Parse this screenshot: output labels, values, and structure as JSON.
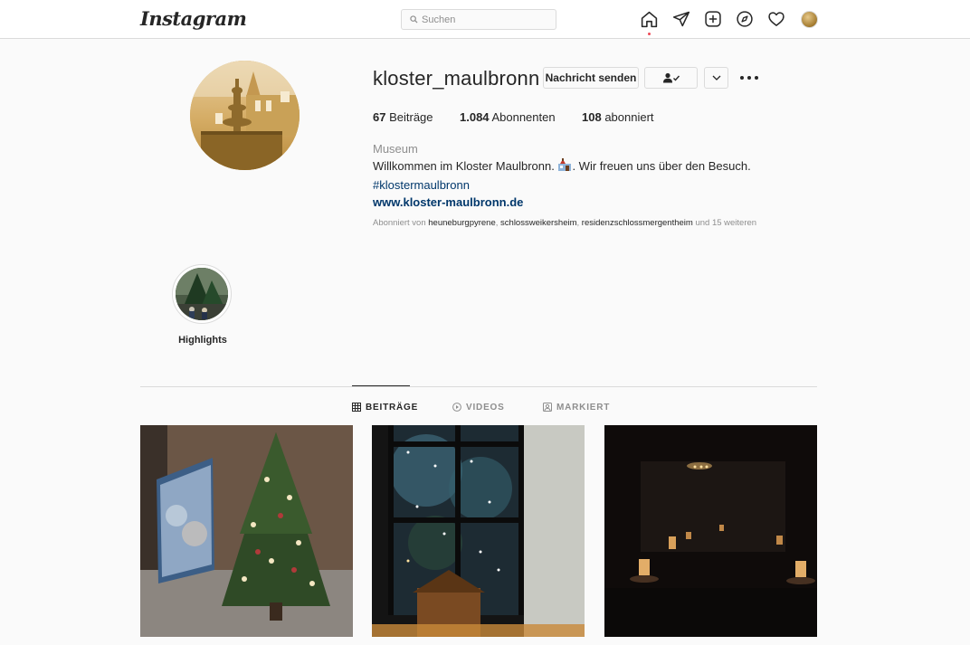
{
  "nav": {
    "logo": "Instagram",
    "search_placeholder": "Suchen"
  },
  "profile": {
    "username": "kloster_maulbronn",
    "buttons": {
      "message": "Nachricht senden"
    },
    "stats": {
      "posts_count": "67",
      "posts_label": "Beiträge",
      "followers_count": "1.084",
      "followers_label": "Abonnenten",
      "following_count": "108",
      "following_label": "abonniert"
    },
    "bio": {
      "category": "Museum",
      "line1_a": "Willkommen im Kloster Maulbronn. ",
      "line1_b": ". Wir freuen uns über den Besuch.",
      "hashtag": "#klostermaulbronn",
      "website": "www.kloster-maulbronn.de"
    },
    "followed_by": {
      "prefix": "Abonniert von ",
      "user1": "heuneburgpyrene",
      "sep1": ", ",
      "user2": "schlossweikersheim",
      "sep2": ", ",
      "user3": "residenzschlossmergentheim",
      "suffix": " und 15 weiteren"
    }
  },
  "highlights": [
    {
      "label": "Highlights"
    }
  ],
  "tabs": {
    "posts": "BEITRÄGE",
    "videos": "VIDEOS",
    "tagged": "MARKIERT"
  },
  "colors": {
    "accent_link": "#00376b",
    "notification_dot": "#ed4956",
    "border": "#dbdbdb"
  }
}
